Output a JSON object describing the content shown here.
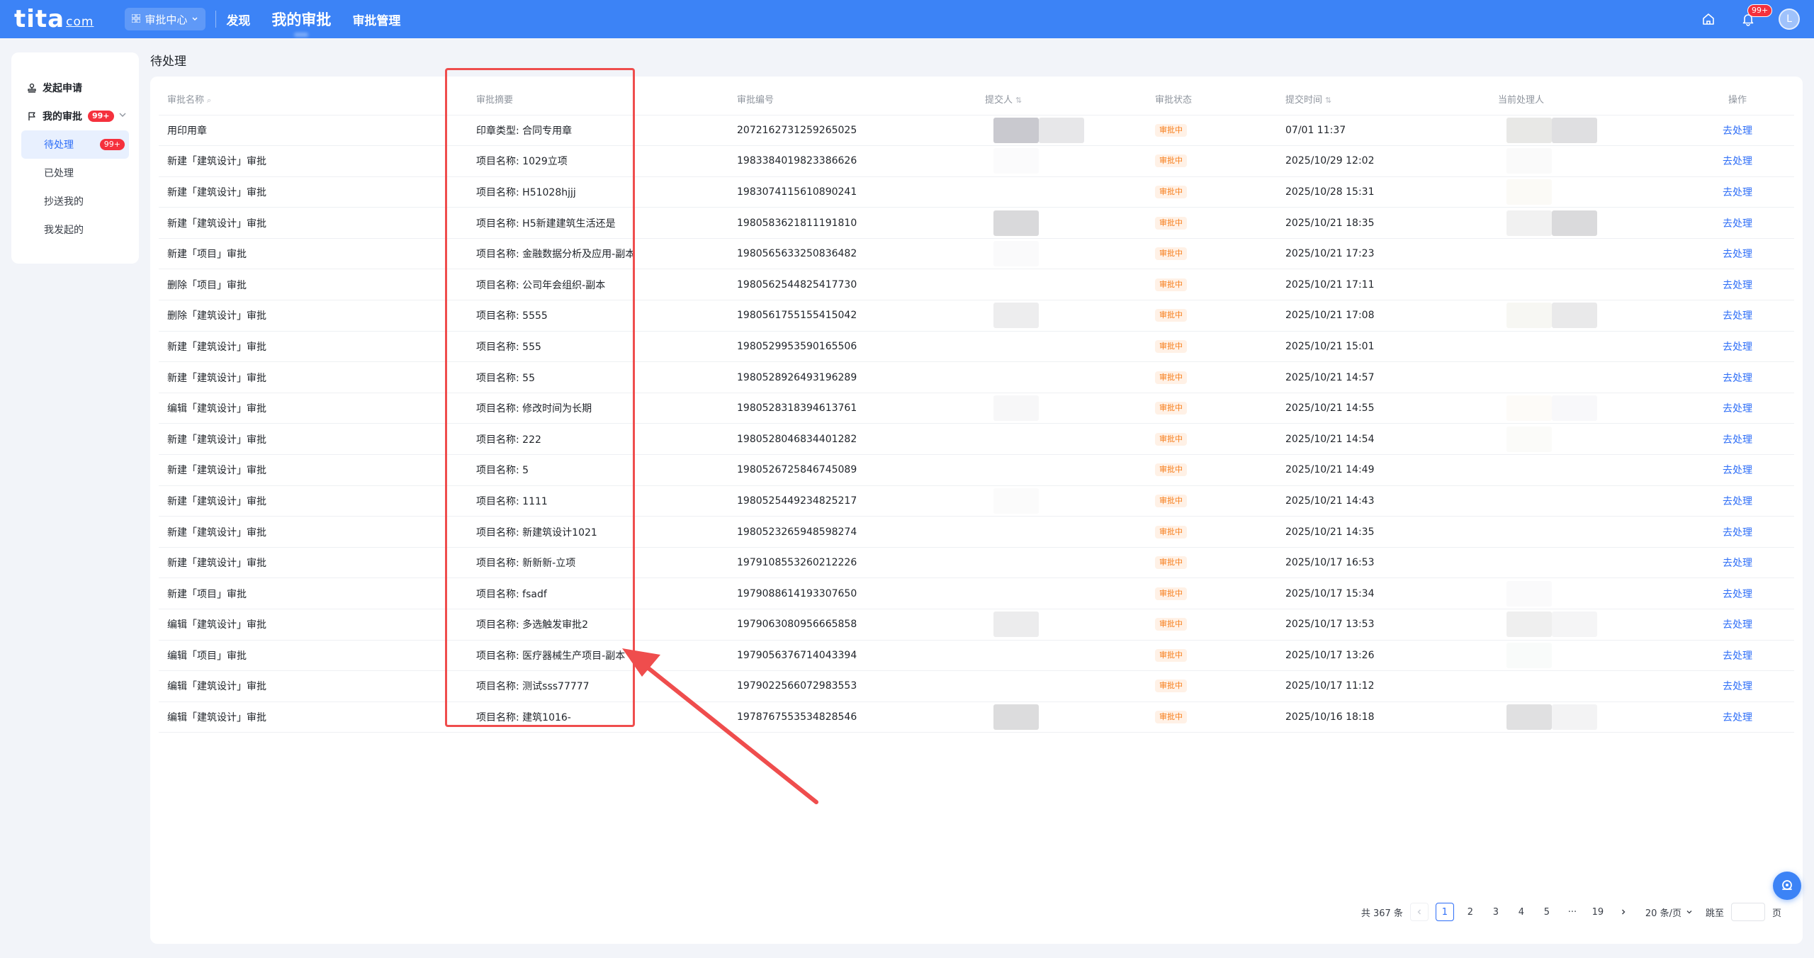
{
  "topbar": {
    "logo": "tita",
    "logo_suffix": "com",
    "app_switch": "审批中心",
    "nav": [
      "发现",
      "我的审批",
      "审批管理"
    ],
    "notify_badge": "99+",
    "avatar": "L"
  },
  "sidebar": {
    "start": "发起申请",
    "my_approval": "我的审批",
    "my_approval_badge": "99+",
    "items": [
      {
        "label": "待处理",
        "badge": "99+"
      },
      {
        "label": "已处理"
      },
      {
        "label": "抄送我的"
      },
      {
        "label": "我发起的"
      }
    ]
  },
  "page_title": "待处理",
  "table": {
    "headers": [
      "审批名称",
      "审批摘要",
      "审批编号",
      "提交人",
      "审批状态",
      "提交时间",
      "当前处理人",
      "操作"
    ],
    "rows": [
      {
        "name": "用印用章",
        "summary": "印章类型: 合同专用章",
        "id": "2072162731259265025",
        "status": "审批中",
        "time": "07/01 11:37",
        "op": "去处理"
      },
      {
        "name": "新建「建筑设计」审批",
        "summary": "项目名称: 1029立项",
        "id": "1983384019823386626",
        "status": "审批中",
        "time": "2025/10/29 12:02",
        "op": "去处理"
      },
      {
        "name": "新建「建筑设计」审批",
        "summary": "项目名称: H51028hjjj",
        "id": "1983074115610890241",
        "status": "审批中",
        "time": "2025/10/28 15:31",
        "op": "去处理"
      },
      {
        "name": "新建「建筑设计」审批",
        "summary": "项目名称: H5新建建筑生活还是",
        "id": "1980583621811191810",
        "status": "审批中",
        "time": "2025/10/21 18:35",
        "op": "去处理"
      },
      {
        "name": "新建「项目」审批",
        "summary": "项目名称: 金融数据分析及应用-副本",
        "id": "1980565633250836482",
        "status": "审批中",
        "time": "2025/10/21 17:23",
        "op": "去处理"
      },
      {
        "name": "删除「项目」审批",
        "summary": "项目名称: 公司年会组织-副本",
        "id": "1980562544825417730",
        "status": "审批中",
        "time": "2025/10/21 17:11",
        "op": "去处理"
      },
      {
        "name": "删除「建筑设计」审批",
        "summary": "项目名称: 5555",
        "id": "1980561755155415042",
        "status": "审批中",
        "time": "2025/10/21 17:08",
        "op": "去处理"
      },
      {
        "name": "新建「建筑设计」审批",
        "summary": "项目名称: 555",
        "id": "1980529953590165506",
        "status": "审批中",
        "time": "2025/10/21 15:01",
        "op": "去处理"
      },
      {
        "name": "新建「建筑设计」审批",
        "summary": "项目名称: 55",
        "id": "1980528926493196289",
        "status": "审批中",
        "time": "2025/10/21 14:57",
        "op": "去处理"
      },
      {
        "name": "编辑「建筑设计」审批",
        "summary": "项目名称: 修改时间为长期",
        "id": "1980528318394613761",
        "status": "审批中",
        "time": "2025/10/21 14:55",
        "op": "去处理"
      },
      {
        "name": "新建「建筑设计」审批",
        "summary": "项目名称: 222",
        "id": "1980528046834401282",
        "status": "审批中",
        "time": "2025/10/21 14:54",
        "op": "去处理"
      },
      {
        "name": "新建「建筑设计」审批",
        "summary": "项目名称: 5",
        "id": "1980526725846745089",
        "status": "审批中",
        "time": "2025/10/21 14:49",
        "op": "去处理"
      },
      {
        "name": "新建「建筑设计」审批",
        "summary": "项目名称: 1111",
        "id": "1980525449234825217",
        "status": "审批中",
        "time": "2025/10/21 14:43",
        "op": "去处理"
      },
      {
        "name": "新建「建筑设计」审批",
        "summary": "项目名称: 新建筑设计1021",
        "id": "1980523265948598274",
        "status": "审批中",
        "time": "2025/10/21 14:35",
        "op": "去处理"
      },
      {
        "name": "新建「建筑设计」审批",
        "summary": "项目名称: 新新新-立项",
        "id": "1979108553260212226",
        "status": "审批中",
        "time": "2025/10/17 16:53",
        "op": "去处理"
      },
      {
        "name": "新建「项目」审批",
        "summary": "项目名称: fsadf",
        "id": "1979088614193307650",
        "status": "审批中",
        "time": "2025/10/17 15:34",
        "op": "去处理"
      },
      {
        "name": "编辑「建筑设计」审批",
        "summary": "项目名称: 多选触发审批2",
        "id": "1979063080956665858",
        "status": "审批中",
        "time": "2025/10/17 13:53",
        "op": "去处理"
      },
      {
        "name": "编辑「项目」审批",
        "summary": "项目名称: 医疗器械生产项目-副本",
        "id": "1979056376714043394",
        "status": "审批中",
        "time": "2025/10/17 13:26",
        "op": "去处理"
      },
      {
        "name": "编辑「建筑设计」审批",
        "summary": "项目名称: 测试sss77777",
        "id": "1979022566072983553",
        "status": "审批中",
        "time": "2025/10/17 11:12",
        "op": "去处理"
      },
      {
        "name": "编辑「建筑设计」审批",
        "summary": "项目名称: 建筑1016-",
        "id": "1978767553534828546",
        "status": "审批中",
        "time": "2025/10/16 18:18",
        "op": "去处理"
      }
    ]
  },
  "pager": {
    "total": "共 367 条",
    "pages": [
      "1",
      "2",
      "3",
      "4",
      "5",
      "···",
      "19"
    ],
    "size": "20 条/页",
    "jump": "跳至",
    "page_unit": "页"
  },
  "colors": {
    "primary": "#3c83f6",
    "highlight": "#ef4d4d",
    "status": "#f77e1b"
  }
}
